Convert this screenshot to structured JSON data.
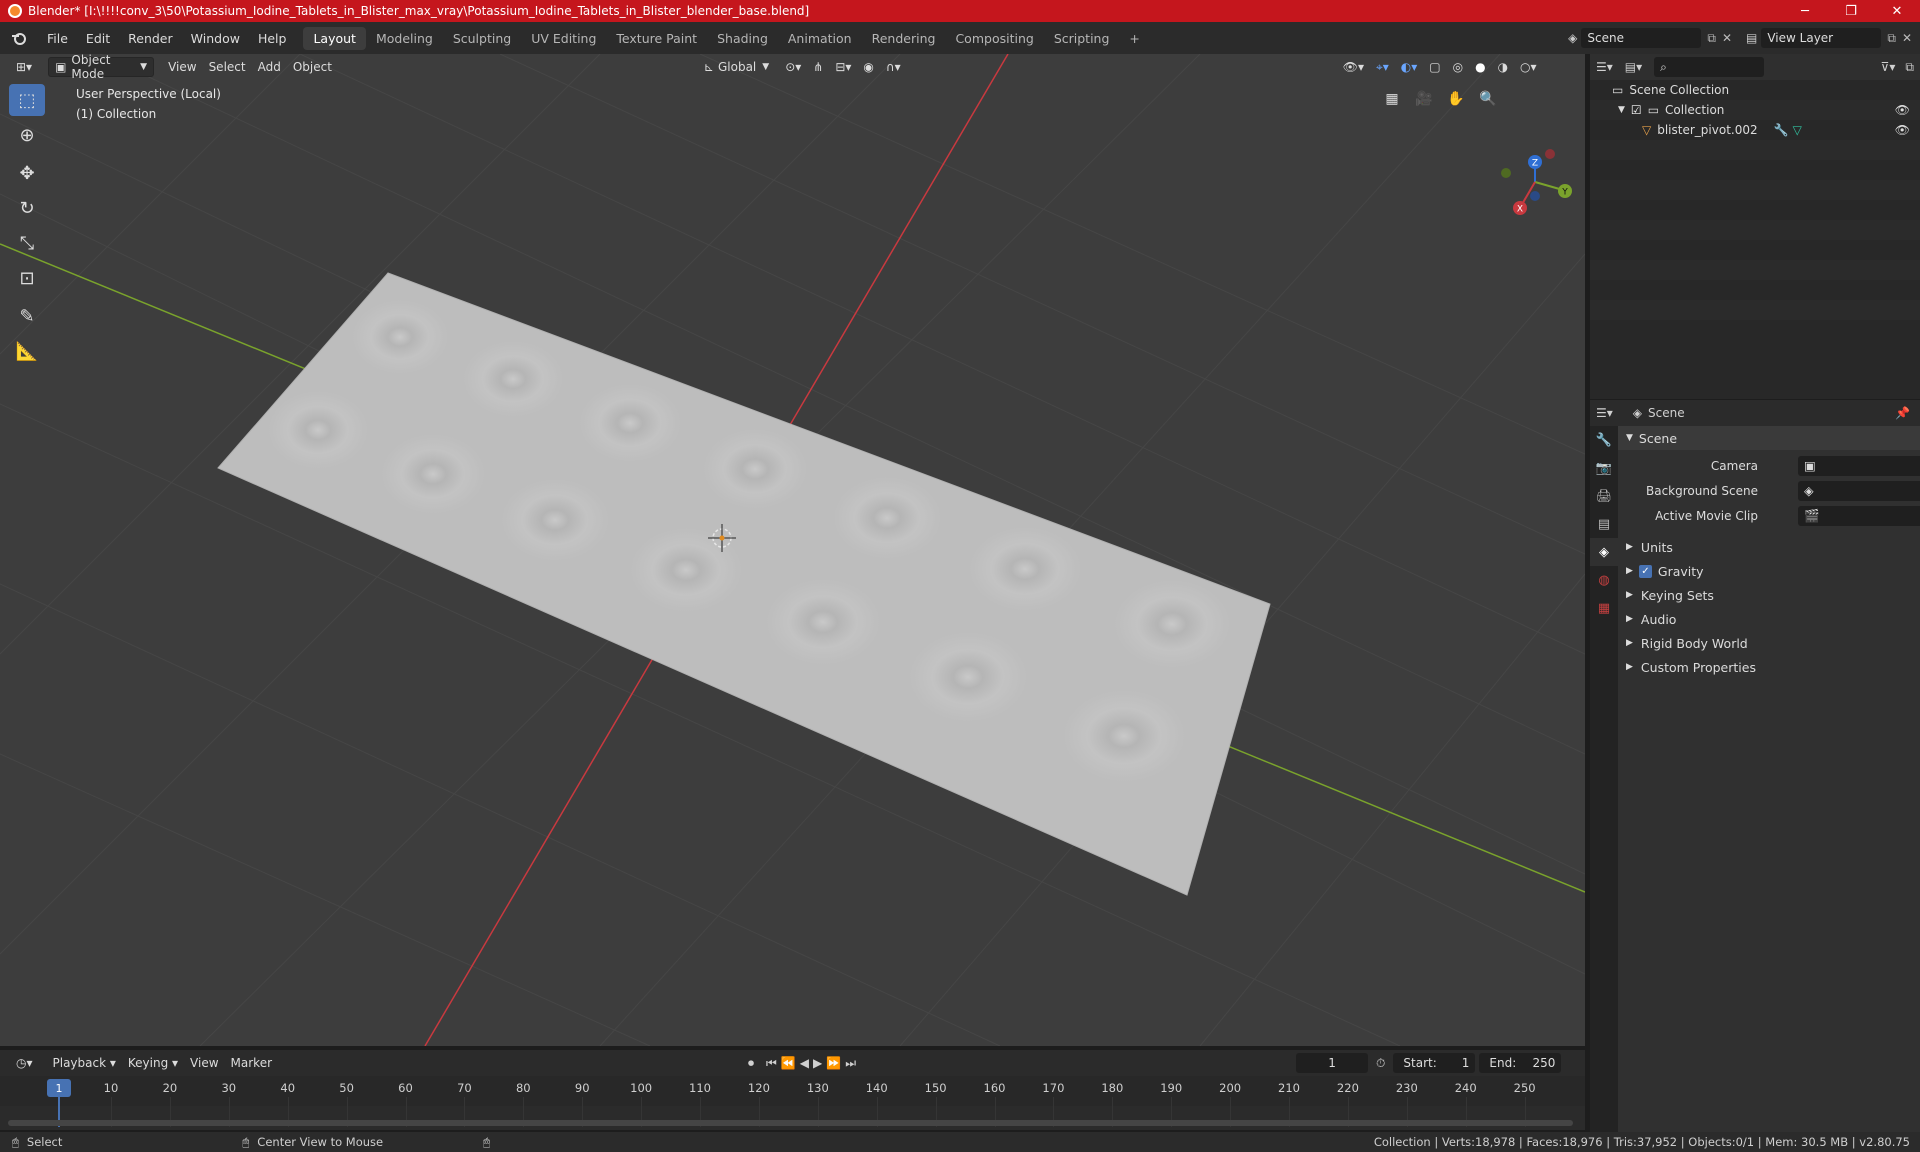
{
  "window": {
    "title": "Blender* [I:\\!!!!conv_3\\50\\Potassium_Iodine_Tablets_in_Blister_max_vray\\Potassium_Iodine_Tablets_in_Blister_blender_base.blend]",
    "minimize": "─",
    "maximize": "❐",
    "close": "✕"
  },
  "menu": [
    "File",
    "Edit",
    "Render",
    "Window",
    "Help"
  ],
  "workspaces": [
    "Layout",
    "Modeling",
    "Sculpting",
    "UV Editing",
    "Texture Paint",
    "Shading",
    "Animation",
    "Rendering",
    "Compositing",
    "Scripting"
  ],
  "active_workspace": "Layout",
  "scene_name": "Scene",
  "view_layer": "View Layer",
  "viewport": {
    "mode": "Object Mode",
    "menus": [
      "View",
      "Select",
      "Add",
      "Object"
    ],
    "orientation": "Global",
    "info_line1": "User Perspective (Local)",
    "info_line2": "(1) Collection",
    "gizmo_labels": {
      "x": "X",
      "y": "Y",
      "z": "Z"
    }
  },
  "outliner": {
    "root": "Scene Collection",
    "collection": "Collection",
    "object": "blister_pivot.002"
  },
  "properties": {
    "header": "Scene",
    "panel": "Scene",
    "camera_label": "Camera",
    "background_scene_label": "Background Scene",
    "active_clip_label": "Active Movie Clip",
    "sections": [
      "Units",
      "Gravity",
      "Keying Sets",
      "Audio",
      "Rigid Body World",
      "Custom Properties"
    ],
    "gravity_checked": true
  },
  "timeline": {
    "menus": [
      "Playback",
      "Keying",
      "View",
      "Marker"
    ],
    "current_frame": "1",
    "start_label": "Start:",
    "start": "1",
    "end_label": "End:",
    "end": "250",
    "ticks": [
      "1",
      "10",
      "20",
      "30",
      "40",
      "50",
      "60",
      "70",
      "80",
      "90",
      "100",
      "110",
      "120",
      "130",
      "140",
      "150",
      "160",
      "170",
      "180",
      "190",
      "200",
      "210",
      "220",
      "230",
      "240",
      "250"
    ]
  },
  "statusbar": {
    "left1": "Select",
    "left2": "Center View to Mouse",
    "right": "Collection | Verts:18,978 | Faces:18,976 | Tris:37,952 | Objects:0/1 | Mem: 30.5 MB | v2.80.75"
  },
  "colors": {
    "title_bg": "#c5161d",
    "viewport_bg": "#3d3d3d",
    "accent": "#4772b3",
    "x_axis": "#c8393f",
    "y_axis": "#7aa32c",
    "z_axis": "#2f6fd4"
  }
}
